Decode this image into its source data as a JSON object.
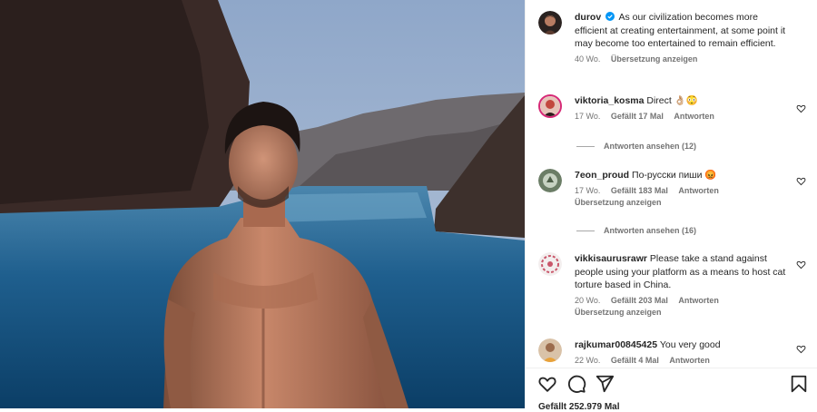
{
  "post": {
    "author": "durov",
    "caption": "As our civilization becomes more efficient at creating entertainment, at some point it may become too entertained to remain efficient.",
    "age": "40 Wo.",
    "translate": "Übersetzung anzeigen"
  },
  "comments": [
    {
      "user": "viktoria_kosma",
      "text": "Direct 👌🏼😳",
      "age": "17 Wo.",
      "likes": "Gefällt 17 Mal",
      "reply": "Antworten",
      "translate": "",
      "view_replies": "Antworten ansehen (12)"
    },
    {
      "user": "7eon_proud",
      "text": "По-русски пиши 😡",
      "age": "17 Wo.",
      "likes": "Gefällt 183 Mal",
      "reply": "Antworten",
      "translate": "Übersetzung anzeigen",
      "view_replies": "Antworten ansehen (16)"
    },
    {
      "user": "vikkisaurusrawr",
      "text": "Please take a stand against people using your platform as a means to host cat torture based in China.",
      "age": "20 Wo.",
      "likes": "Gefällt 203 Mal",
      "reply": "Antworten",
      "translate": "Übersetzung anzeigen",
      "view_replies": ""
    },
    {
      "user": "rajkumar00845425",
      "text": "You very good",
      "age": "22 Wo.",
      "likes": "Gefällt 4 Mal",
      "reply": "Antworten",
      "translate": "",
      "view_replies": ""
    }
  ],
  "actions": {
    "like_icon": "heart-icon",
    "comment_icon": "comment-icon",
    "share_icon": "share-icon",
    "save_icon": "bookmark-icon",
    "likes_count": "Gefällt 252.979 Mal"
  },
  "colors": {
    "verified": "#0095f6",
    "muted": "#737373",
    "text": "#262626"
  }
}
